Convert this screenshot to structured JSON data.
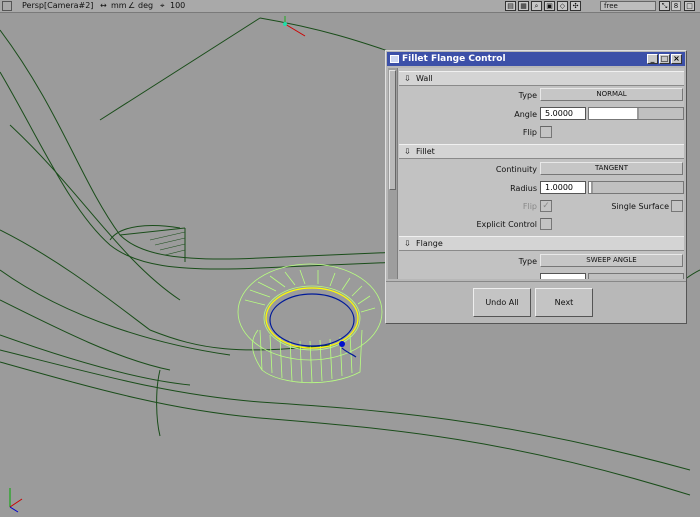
{
  "toolbar": {
    "viewport_title": "Persp[Camera#2]",
    "linear_unit": "mm",
    "angle_unit": "deg",
    "scale_value": "100",
    "camera_mode": "free",
    "counter": "8"
  },
  "dialog": {
    "title": "Fillet Flange Control",
    "wall": {
      "header": "Wall",
      "type_label": "Type",
      "type_value": "NORMAL",
      "angle_label": "Angle",
      "angle_value": "5.0000",
      "angle_slider_fraction": 0.5,
      "flip_label": "Flip"
    },
    "fillet": {
      "header": "Fillet",
      "continuity_label": "Continuity",
      "continuity_value": "TANGENT",
      "radius_label": "Radius",
      "radius_value": "1.0000",
      "radius_slider_fraction": 0.01,
      "flip_label": "Flip",
      "single_surface_label": "Single Surface",
      "explicit_control_label": "Explicit Control"
    },
    "flange": {
      "header": "Flange",
      "type_label": "Type",
      "type_value": "SWEEP ANGLE"
    },
    "buttons": {
      "undo_all": "Undo All",
      "next": "Next"
    }
  },
  "colors": {
    "title_bar": "#3c50a8",
    "curve_green": "#1a4d1a",
    "selection_green": "#b8ff80",
    "highlight_yellow": "#ffff00"
  }
}
